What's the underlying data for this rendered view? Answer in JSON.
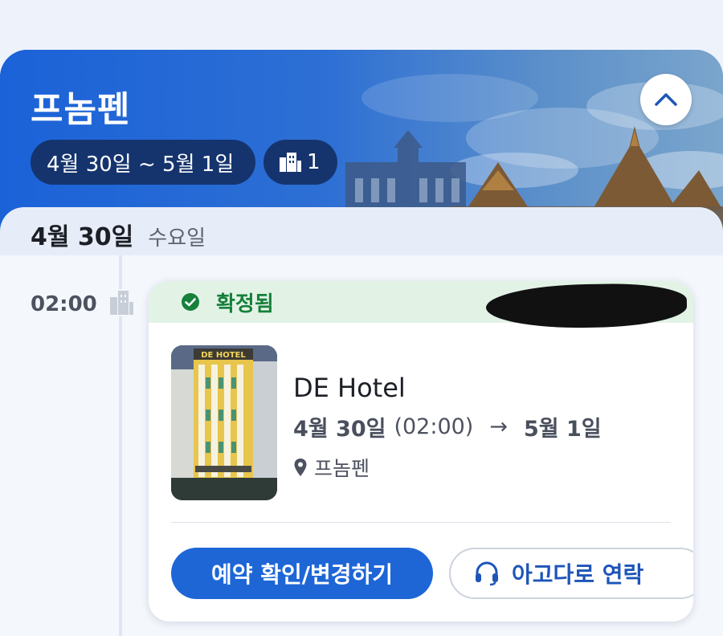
{
  "header": {
    "city": "프놈펜",
    "date_range": "4월 30일 ~ 5월 1일",
    "room_count": "1",
    "collapse_icon": "chevron-up-icon"
  },
  "day": {
    "date": "4월 30일",
    "weekday": "수요일"
  },
  "booking": {
    "time": "02:00",
    "status": "확정됨",
    "hotel_name": "DE Hotel",
    "thumb_sign": "DE HOTEL",
    "checkin_date": "4월 30일",
    "checkin_time": "(02:00)",
    "arrow": "→",
    "checkout_date": "5월 1일",
    "location": "프놈펜",
    "manage_button": "예약 확인/변경하기",
    "contact_button": "아고다로 연락"
  },
  "colors": {
    "brand_blue": "#1e66d6",
    "header_pill": "#15346e",
    "status_green": "#17803a",
    "status_bg": "#e2f3e6"
  }
}
